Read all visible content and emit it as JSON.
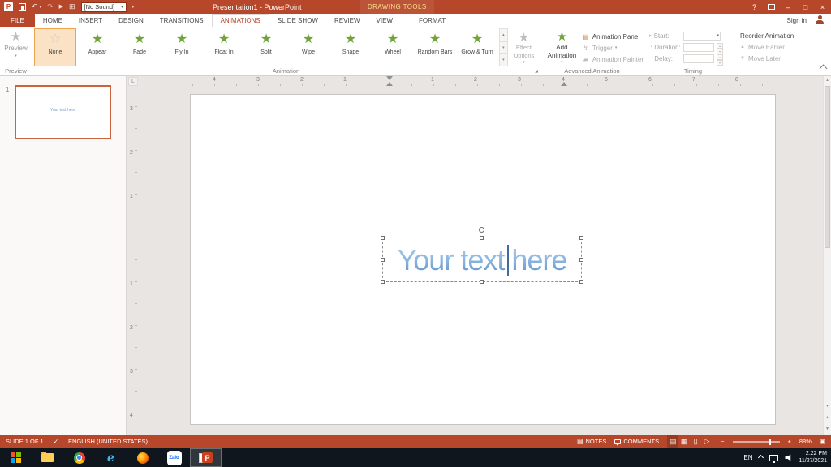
{
  "colors": {
    "accent": "#B7472A",
    "gallery_selected_bg": "#FCE2C5",
    "gallery_selected_border": "#EDA44D",
    "star_green": "#71A33A",
    "slide_text_gradient_top": "#BAD6EE",
    "slide_text_gradient_bottom": "#4E87C2",
    "taskbar_bg": "#10161D"
  },
  "titlebar": {
    "title": "Presentation1 - PowerPoint",
    "contextual_label": "DRAWING TOOLS",
    "sound_value": "[No Sound]"
  },
  "tabs": [
    {
      "label": "FILE"
    },
    {
      "label": "HOME"
    },
    {
      "label": "INSERT"
    },
    {
      "label": "DESIGN"
    },
    {
      "label": "TRANSITIONS"
    },
    {
      "label": "ANIMATIONS"
    },
    {
      "label": "SLIDE SHOW"
    },
    {
      "label": "REVIEW"
    },
    {
      "label": "VIEW"
    },
    {
      "label": "FORMAT"
    }
  ],
  "sign_in": "Sign in",
  "ribbon": {
    "preview": {
      "button": "Preview",
      "group_label": "Preview"
    },
    "animation": {
      "group_label": "Animation",
      "items": [
        {
          "label": "None"
        },
        {
          "label": "Appear"
        },
        {
          "label": "Fade"
        },
        {
          "label": "Fly In"
        },
        {
          "label": "Float In"
        },
        {
          "label": "Split"
        },
        {
          "label": "Wipe"
        },
        {
          "label": "Shape"
        },
        {
          "label": "Wheel"
        },
        {
          "label": "Random Bars"
        },
        {
          "label": "Grow & Turn"
        }
      ],
      "effect_options_line1": "Effect",
      "effect_options_line2": "Options"
    },
    "advanced": {
      "group_label": "Advanced Animation",
      "add_line1": "Add",
      "add_line2": "Animation",
      "animation_pane": "Animation Pane",
      "trigger": "Trigger",
      "animation_painter": "Animation Painter"
    },
    "timing": {
      "group_label": "Timing",
      "start": "Start:",
      "duration": "Duration:",
      "delay": "Delay:",
      "reorder_title": "Reorder Animation",
      "move_earlier": "Move Earlier",
      "move_later": "Move Later"
    }
  },
  "slide_panel": {
    "slide_number": "1",
    "thumb_text": "Your text here"
  },
  "editor": {
    "slide_text": "Your text here",
    "ruler_h": [
      "4",
      "3",
      "2",
      "1",
      "1",
      "2",
      "3",
      "4",
      "5",
      "6",
      "7",
      "8"
    ],
    "ruler_v": [
      "3",
      "2",
      "1",
      "1",
      "2",
      "3",
      "4"
    ],
    "tab_selector": "L"
  },
  "statusbar": {
    "slide_info": "SLIDE 1 OF 1",
    "language": "ENGLISH (UNITED STATES)",
    "notes": "NOTES",
    "comments": "COMMENTS",
    "zoom_percent": "88%"
  },
  "taskbar": {
    "zalo_label": "Zalo",
    "ppt_letter": "P",
    "lang": "EN",
    "time": "2:22 PM",
    "date": "11/27/2021"
  },
  "icons": {
    "app": "P",
    "undo": "↶",
    "redo": "↷",
    "caret_down": "▾",
    "caret_up": "▴",
    "slideshow": "▶",
    "touch": "⊞",
    "help": "?",
    "minimize": "–",
    "maximize": "□",
    "close": "×",
    "star": "★",
    "star_outline": "☆",
    "pane": "▤",
    "trigger": "↯",
    "painter": "▰",
    "start": "▸",
    "clock": "◔",
    "earlier": "▲",
    "later": "▼",
    "launcher": "◢",
    "spell": "✓",
    "notes": "▤",
    "view_normal": "▤",
    "view_sorter": "▦",
    "view_reading": "▯",
    "view_slideshow": "▷",
    "zoom_out": "−",
    "zoom_in": "+",
    "fit": "▣",
    "ie_letter": "e"
  }
}
